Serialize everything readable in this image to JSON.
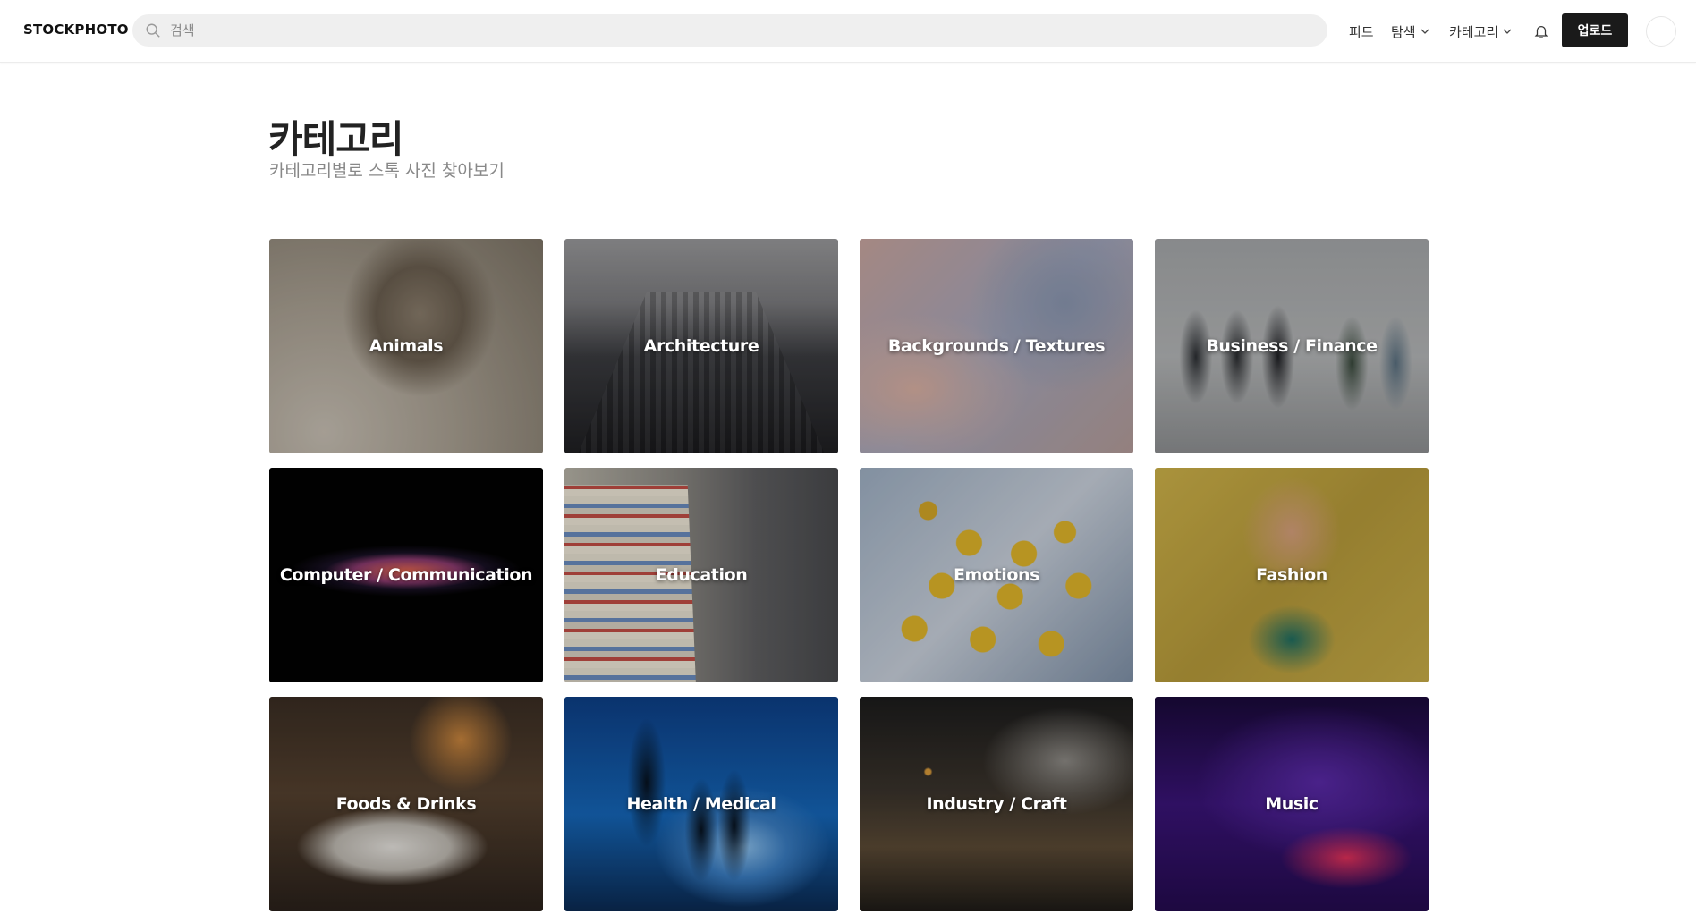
{
  "header": {
    "logo": "STOCKPHOTO",
    "search": {
      "placeholder": "검색",
      "value": ""
    },
    "nav": {
      "feed": "피드",
      "explore": "탐색",
      "category": "카테고리"
    },
    "upload_label": "업로드"
  },
  "page": {
    "title": "카테고리",
    "subtitle": "카테고리별로 스톡 사진 찾아보기"
  },
  "categories": [
    {
      "label": "Animals"
    },
    {
      "label": "Architecture"
    },
    {
      "label": "Backgrounds / Textures"
    },
    {
      "label": "Business / Finance"
    },
    {
      "label": "Computer / Communication"
    },
    {
      "label": "Education"
    },
    {
      "label": "Emotions"
    },
    {
      "label": "Fashion"
    },
    {
      "label": "Foods & Drinks"
    },
    {
      "label": "Health / Medical"
    },
    {
      "label": "Industry / Craft"
    },
    {
      "label": "Music"
    }
  ],
  "colors": {
    "upload_button_bg": "#1a1a1a",
    "search_bg": "#efefef"
  }
}
